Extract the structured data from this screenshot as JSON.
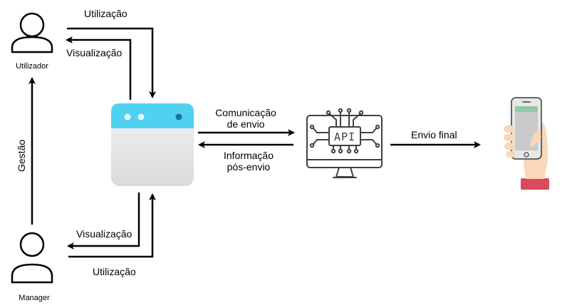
{
  "actors": {
    "top": "Utilizador",
    "bottom": "Manager"
  },
  "edges": {
    "top_use": "Utilização",
    "top_view": "Visualização",
    "bottom_view": "Visualização",
    "bottom_use": "Utilização",
    "management": "Gestão",
    "comm_line1": "Comunicação",
    "comm_line2": "de envio",
    "info_line1": "Informação",
    "info_line2": "pós-envio",
    "final": "Envio final"
  },
  "api": {
    "chip_text": "API"
  },
  "colors": {
    "app_header": "#4FD1F0",
    "app_body": "#E6E6E6",
    "stroke": "#000000",
    "monitor": "#404040",
    "hand_skin": "#F9D7B8",
    "cuff": "#D94A5A",
    "phone_screen": "#C9C9C9",
    "phone_screen_top": "#8FC9A6"
  },
  "icons": [
    "user-icon",
    "app-window-icon",
    "api-monitor-icon",
    "hand-phone-icon"
  ]
}
